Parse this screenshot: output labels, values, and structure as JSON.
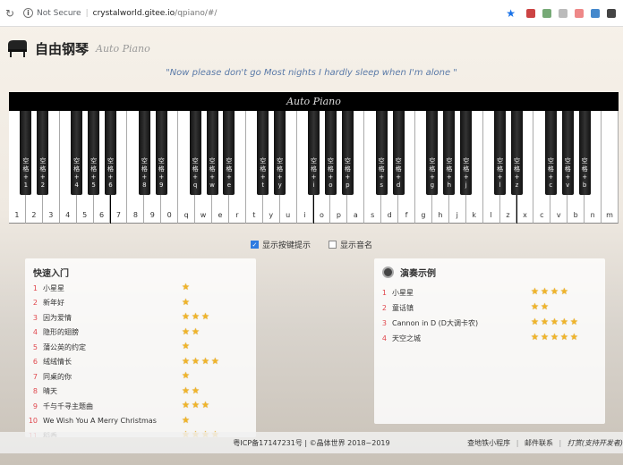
{
  "browser": {
    "not_secure": "Not Secure",
    "url_host": "crystalworld.gitee.io",
    "url_path": "/qpiano/#/"
  },
  "header": {
    "title": "自由钢琴",
    "subtitle": "Auto Piano"
  },
  "lyric": "\"Now please don't go Most nights I hardly sleep when I'm alone \"",
  "piano": {
    "brand": "Auto Piano",
    "white_keys": [
      "1",
      "2",
      "3",
      "4",
      "5",
      "6",
      "7",
      "8",
      "9",
      "0",
      "q",
      "w",
      "e",
      "r",
      "t",
      "y",
      "u",
      "i",
      "o",
      "p",
      "a",
      "s",
      "d",
      "f",
      "g",
      "h",
      "j",
      "k",
      "l",
      "z",
      "x",
      "c",
      "v",
      "b",
      "n",
      "m"
    ],
    "black_keys": [
      {
        "after": 0,
        "label": "空\n格\n+\n1"
      },
      {
        "after": 1,
        "label": "空\n格\n+\n2"
      },
      {
        "after": 3,
        "label": "空\n格\n+\n4"
      },
      {
        "after": 4,
        "label": "空\n格\n+\n5"
      },
      {
        "after": 5,
        "label": "空\n格\n+\n6"
      },
      {
        "after": 7,
        "label": "空\n格\n+\n8"
      },
      {
        "after": 8,
        "label": "空\n格\n+\n9"
      },
      {
        "after": 10,
        "label": "空\n格\n+\nq"
      },
      {
        "after": 11,
        "label": "空\n格\n+\nw"
      },
      {
        "after": 12,
        "label": "空\n格\n+\ne"
      },
      {
        "after": 14,
        "label": "空\n格\n+\nt"
      },
      {
        "after": 15,
        "label": "空\n格\n+\ny"
      },
      {
        "after": 17,
        "label": "空\n格\n+\ni"
      },
      {
        "after": 18,
        "label": "空\n格\n+\no"
      },
      {
        "after": 19,
        "label": "空\n格\n+\np"
      },
      {
        "after": 21,
        "label": "空\n格\n+\ns"
      },
      {
        "after": 22,
        "label": "空\n格\n+\nd"
      },
      {
        "after": 24,
        "label": "空\n格\n+\ng"
      },
      {
        "after": 25,
        "label": "空\n格\n+\nh"
      },
      {
        "after": 26,
        "label": "空\n格\n+\nj"
      },
      {
        "after": 28,
        "label": "空\n格\n+\nl"
      },
      {
        "after": 29,
        "label": "空\n格\n+\nz"
      },
      {
        "after": 31,
        "label": "空\n格\n+\nc"
      },
      {
        "after": 32,
        "label": "空\n格\n+\nv"
      },
      {
        "after": 33,
        "label": "空\n格\n+\nb"
      }
    ]
  },
  "options": {
    "show_hints": "显示按键提示",
    "show_hints_checked": true,
    "show_notes": "显示音名",
    "show_notes_checked": false
  },
  "quick_start": {
    "title": "快速入门",
    "songs": [
      {
        "idx": "1",
        "name": "小星星",
        "stars": 1
      },
      {
        "idx": "2",
        "name": "新年好",
        "stars": 1
      },
      {
        "idx": "3",
        "name": "因为爱情",
        "stars": 3
      },
      {
        "idx": "4",
        "name": "隐形的翅膀",
        "stars": 2
      },
      {
        "idx": "5",
        "name": "蒲公英的约定",
        "stars": 1
      },
      {
        "idx": "6",
        "name": "绒绒情长",
        "stars": 4
      },
      {
        "idx": "7",
        "name": "同桌的你",
        "stars": 1
      },
      {
        "idx": "8",
        "name": "晴天",
        "stars": 2
      },
      {
        "idx": "9",
        "name": "千与千寻主题曲",
        "stars": 3
      },
      {
        "idx": "10",
        "name": "We Wish You A Merry Christmas",
        "stars": 1
      },
      {
        "idx": "11",
        "name": "稻香",
        "stars": 4
      }
    ]
  },
  "demos": {
    "title": "演奏示例",
    "songs": [
      {
        "idx": "1",
        "name": "小星星",
        "stars": 4
      },
      {
        "idx": "2",
        "name": "童话镇",
        "stars": 2
      },
      {
        "idx": "3",
        "name": "Cannon in D (D大调卡农)",
        "stars": 5
      },
      {
        "idx": "4",
        "name": "天空之城",
        "stars": 5
      }
    ]
  },
  "footer": {
    "icp": "粤ICP备17147231号 | ©晶体世界 2018~2019",
    "link_miniapp": "查地铁小程序",
    "link_mail": "邮件联系",
    "link_support": "打赏(支持开发者)"
  },
  "colors": {
    "accent": "#2f7be0",
    "index_red": "#e0484e",
    "star": "#f0b429"
  }
}
